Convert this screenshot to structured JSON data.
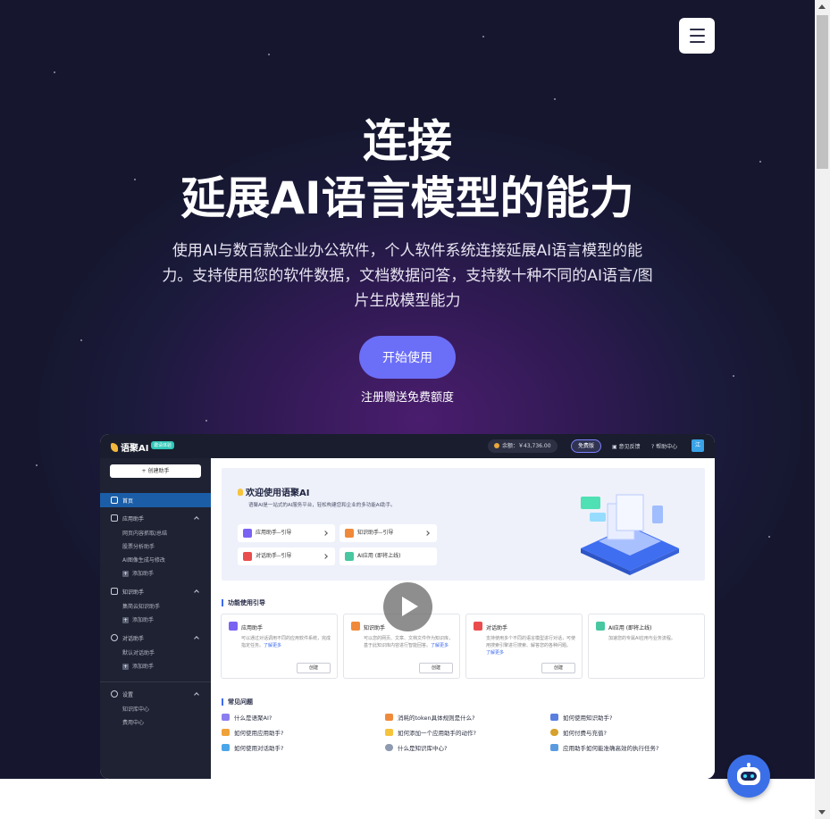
{
  "hero": {
    "title_line1": "连接",
    "title_line2": "延展AI语言模型的能力",
    "description": "使用AI与数百款企业办公软件，个人软件系统连接延展AI语言模型的能力。支持使用您的软件数据，文档数据问答，支持数十种不同的AI语言/图片生成模型能力",
    "start_button": "开始使用",
    "signup_note": "注册赠送免费额度"
  },
  "menu": {
    "icon": "hamburger-menu-icon"
  },
  "app_preview": {
    "topbar": {
      "logo": "语聚AI",
      "badge": "邀请体验",
      "balance": "余额：￥43,736.00",
      "free_button": "免费版",
      "feedback": "意见反馈",
      "help": "帮助中心",
      "avatar": "江"
    },
    "sidebar": {
      "create_button": "+ 创建助手",
      "home": "首页",
      "groups": [
        {
          "label": "应用助手",
          "items": [
            "网页内容抓取/总结",
            "股票分析助手",
            "AI图像生成与修改"
          ],
          "add": "添加助手"
        },
        {
          "label": "知识助手",
          "items": [
            "集简云知识助手"
          ],
          "add": "添加助手"
        },
        {
          "label": "对话助手",
          "items": [
            "默认对话助手"
          ],
          "add": "添加助手"
        },
        {
          "label": "设置",
          "items": [
            "知识库中心",
            "费用中心"
          ]
        }
      ]
    },
    "welcome": {
      "title": "欢迎使用语聚AI",
      "subtitle": "语聚AI是一站式的AI服务平台，轻松构建您和企业的多功能AI助手。",
      "guides": [
        "应用助手--引导",
        "知识助手--引导",
        "对话助手--引导",
        "AI应用 (即将上线)"
      ]
    },
    "features": {
      "title": "功能使用引导",
      "cards": [
        {
          "title": "应用助手",
          "desc": "可以通过对话调用不同的应用软件系统，完成指定任务。",
          "link": "了解更多",
          "button": "创建"
        },
        {
          "title": "知识助手",
          "desc": "可以您的网页、文章、文档文件作为知识库，基于此知识库内容进行智能回答。",
          "link": "了解更多",
          "button": "创建"
        },
        {
          "title": "对话助手",
          "desc": "支持使用多个不同的语言模型进行对话，可使用搜索引擎进行搜索、解答您的各种问题。",
          "link": "了解更多",
          "button": "创建"
        },
        {
          "title": "AI应用 (即将上线)",
          "desc": "加速您的专属AI应用与业务流程。",
          "link": "",
          "button": ""
        }
      ]
    },
    "faq": {
      "title": "常见问题",
      "items": [
        "什么是语聚AI?",
        "消耗的token具体规则是什么?",
        "如何使用知识助手?",
        "如何使用应用助手?",
        "如何添加一个应用助手的动作?",
        "如何付费与充值?",
        "如何使用对话助手?",
        "什么是知识库中心?",
        "应用助手如何能准确高效的执行任务?"
      ]
    }
  },
  "colors": {
    "primary_button": "#6b6ef7",
    "hero_dark": "#1b1a3c",
    "hero_glow": "#4a1d6e",
    "app_topbar": "#1a1d2d",
    "sidebar": "#1e2233",
    "sidebar_active": "#1b5ea7",
    "accent_blue": "#3d6bf0"
  }
}
